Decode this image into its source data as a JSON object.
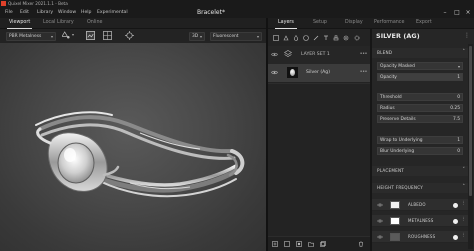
{
  "window": {
    "title": "Quixel Mixer 2021.1.1 - Beta",
    "document_title": "Bracelet*"
  },
  "menu": [
    "File",
    "Edit",
    "Library",
    "Window",
    "Help",
    "Experimental"
  ],
  "viewport_tabs": [
    "Viewport",
    "Local Library",
    "Online"
  ],
  "viewport_toolbar": {
    "shading_mode": "PBR Metalness",
    "view_mode": "3D",
    "environment": "Fluorescent"
  },
  "right_tabs": [
    "Layers",
    "Setup",
    "Display",
    "Performance",
    "Export"
  ],
  "layers": [
    {
      "name": "LAYER SET 1"
    },
    {
      "name": "Silver (Ag)"
    }
  ],
  "properties": {
    "title": "SILVER (AG)",
    "sections": {
      "blend": "BLEND",
      "placement": "PLACEMENT",
      "height_frequency": "HEIGHT FREQUENCY"
    },
    "blend_mode": "Opacity Masked",
    "opacity": {
      "label": "Opacity",
      "value": "1"
    },
    "threshold": {
      "label": "Threshold",
      "value": "0"
    },
    "radius": {
      "label": "Radius",
      "value": "0.25"
    },
    "preserve_details": {
      "label": "Preserve Details",
      "value": "7.5"
    },
    "wrap_to_underlying": {
      "label": "Wrap to Underlying",
      "value": "1"
    },
    "blur_underlying": {
      "label": "Blur Underlying",
      "value": "0"
    },
    "channels": [
      {
        "label": "ALBEDO",
        "swatch": "#f2f2f2"
      },
      {
        "label": "METALNESS",
        "swatch": "#ffffff"
      },
      {
        "label": "ROUGHNESS",
        "swatch": "#5a5a5a"
      }
    ]
  }
}
